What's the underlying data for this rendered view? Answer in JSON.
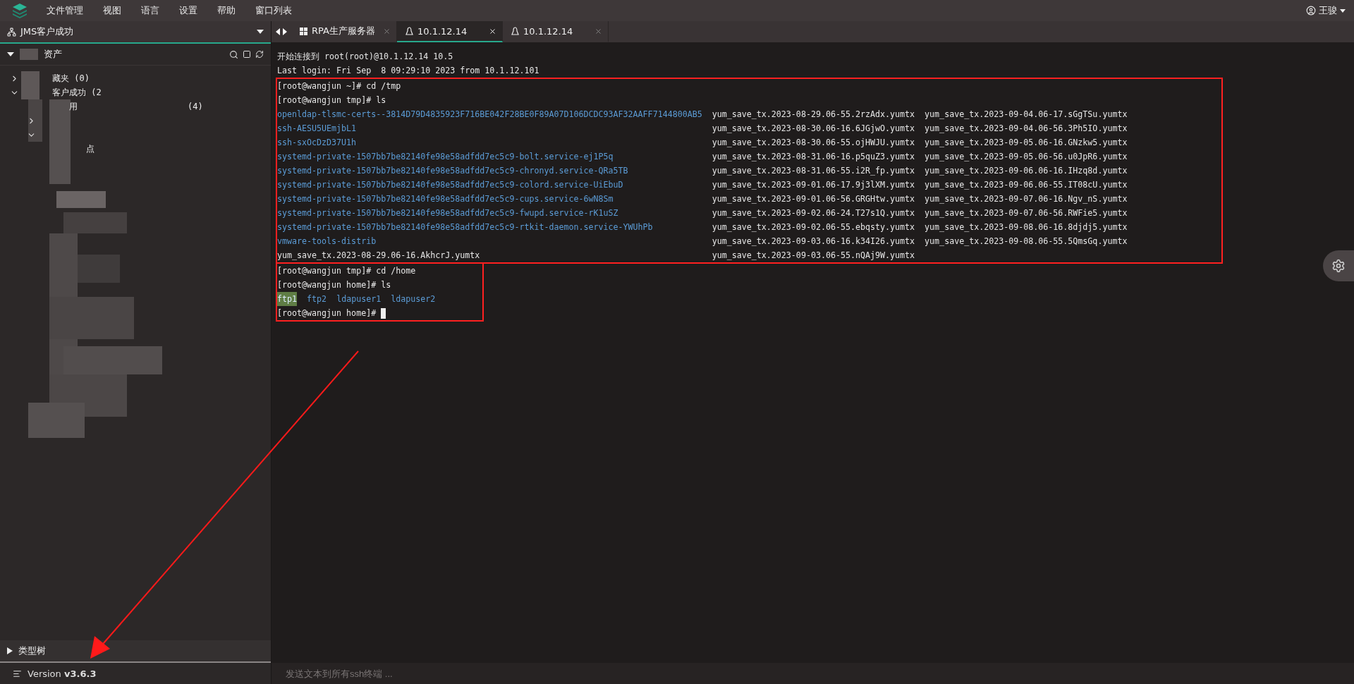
{
  "menu_bar": {
    "items": [
      "文件管理",
      "视图",
      "语言",
      "设置",
      "帮助",
      "窗口列表"
    ],
    "user": "王骏"
  },
  "sidebar": {
    "workspace": "JMS客户成功",
    "section": {
      "title": "资产",
      "expanded": true
    },
    "tree": [
      {
        "label": "藏夹 (0)",
        "expanded": false
      },
      {
        "label": "客户成功 (2",
        "expanded": true,
        "children": [
          {
            "label": "用",
            "count": "(4)"
          },
          {
            "expanded": false
          },
          {
            "expanded": true,
            "children": [
              {
                "label": "点"
              }
            ]
          }
        ]
      }
    ],
    "footer_section": {
      "title": "类型树",
      "expanded": false
    },
    "version_label": "Version",
    "version": "v3.6.3"
  },
  "tabs": [
    {
      "label": "RPA生产服务器",
      "kind": "windows",
      "selected": false
    },
    {
      "label": "10.1.12.14",
      "kind": "linux",
      "selected": true
    },
    {
      "label": "10.1.12.14",
      "kind": "linux",
      "selected": false
    }
  ],
  "terminal": {
    "groups": [
      {
        "highlighted": false,
        "lines": [
          {
            "kind": "text",
            "text": "开始连接到 root(root)@10.1.12.14 10.5"
          },
          {
            "kind": "text",
            "text": "Last login: Fri Sep  8 09:29:10 2023 from 10.1.12.101"
          }
        ]
      },
      {
        "highlighted": true,
        "lines": [
          {
            "kind": "text",
            "text": "[root@wangjun ~]# cd /tmp"
          },
          {
            "kind": "text",
            "text": "[root@wangjun tmp]# ls"
          },
          {
            "kind": "listing",
            "columns": [
              [
                {
                  "name": "openldap-tlsmc-certs--3814D79D4835923F716BE042F28BE0F89A07D106DCDC93AF32AAFF7144800AB5",
                  "kind": "dir"
                },
                {
                  "name": "ssh-AESU5UEmjbL1",
                  "kind": "dir"
                },
                {
                  "name": "ssh-sxOcDzD37U1h",
                  "kind": "dir"
                },
                {
                  "name": "systemd-private-1507bb7be82140fe98e58adfdd7ec5c9-bolt.service-ej1P5q",
                  "kind": "dir"
                },
                {
                  "name": "systemd-private-1507bb7be82140fe98e58adfdd7ec5c9-chronyd.service-QRa5TB",
                  "kind": "dir"
                },
                {
                  "name": "systemd-private-1507bb7be82140fe98e58adfdd7ec5c9-colord.service-UiEbuD",
                  "kind": "dir"
                },
                {
                  "name": "systemd-private-1507bb7be82140fe98e58adfdd7ec5c9-cups.service-6wN8Sm",
                  "kind": "dir"
                },
                {
                  "name": "systemd-private-1507bb7be82140fe98e58adfdd7ec5c9-fwupd.service-rK1uSZ",
                  "kind": "dir"
                },
                {
                  "name": "systemd-private-1507bb7be82140fe98e58adfdd7ec5c9-rtkit-daemon.service-YWUhPb",
                  "kind": "dir"
                },
                {
                  "name": "vmware-tools-distrib",
                  "kind": "dir"
                },
                {
                  "name": "yum_save_tx.2023-08-29.06-16.AkhcrJ.yumtx",
                  "kind": "file"
                }
              ],
              [
                {
                  "name": "yum_save_tx.2023-08-29.06-55.2rzAdx.yumtx",
                  "kind": "file"
                },
                {
                  "name": "yum_save_tx.2023-08-30.06-16.6JGjwO.yumtx",
                  "kind": "file"
                },
                {
                  "name": "yum_save_tx.2023-08-30.06-55.ojHWJU.yumtx",
                  "kind": "file"
                },
                {
                  "name": "yum_save_tx.2023-08-31.06-16.p5quZ3.yumtx",
                  "kind": "file"
                },
                {
                  "name": "yum_save_tx.2023-08-31.06-55.i2R_fp.yumtx",
                  "kind": "file"
                },
                {
                  "name": "yum_save_tx.2023-09-01.06-17.9j3lXM.yumtx",
                  "kind": "file"
                },
                {
                  "name": "yum_save_tx.2023-09-01.06-56.GRGHtw.yumtx",
                  "kind": "file"
                },
                {
                  "name": "yum_save_tx.2023-09-02.06-24.T27s1Q.yumtx",
                  "kind": "file"
                },
                {
                  "name": "yum_save_tx.2023-09-02.06-55.ebqsty.yumtx",
                  "kind": "file"
                },
                {
                  "name": "yum_save_tx.2023-09-03.06-16.k34I26.yumtx",
                  "kind": "file"
                },
                {
                  "name": "yum_save_tx.2023-09-03.06-55.nQAj9W.yumtx",
                  "kind": "file"
                }
              ],
              [
                {
                  "name": "yum_save_tx.2023-09-04.06-17.sGgTSu.yumtx",
                  "kind": "file"
                },
                {
                  "name": "yum_save_tx.2023-09-04.06-56.3Ph5IO.yumtx",
                  "kind": "file"
                },
                {
                  "name": "yum_save_tx.2023-09-05.06-16.GNzkw5.yumtx",
                  "kind": "file"
                },
                {
                  "name": "yum_save_tx.2023-09-05.06-56.u0JpR6.yumtx",
                  "kind": "file"
                },
                {
                  "name": "yum_save_tx.2023-09-06.06-16.IHzq8d.yumtx",
                  "kind": "file"
                },
                {
                  "name": "yum_save_tx.2023-09-06.06-55.IT08cU.yumtx",
                  "kind": "file"
                },
                {
                  "name": "yum_save_tx.2023-09-07.06-16.Ngv_nS.yumtx",
                  "kind": "file"
                },
                {
                  "name": "yum_save_tx.2023-09-07.06-56.RWFie5.yumtx",
                  "kind": "file"
                },
                {
                  "name": "yum_save_tx.2023-09-08.06-16.8djdj5.yumtx",
                  "kind": "file"
                },
                {
                  "name": "yum_save_tx.2023-09-08.06-55.5QmsGq.yumtx",
                  "kind": "file"
                }
              ]
            ]
          }
        ]
      },
      {
        "highlighted": true,
        "lines": [
          {
            "kind": "text",
            "text": "[root@wangjun tmp]# cd /home"
          },
          {
            "kind": "text",
            "text": "[root@wangjun home]# ls"
          },
          {
            "kind": "listing",
            "columns": [
              [
                {
                  "name": "ftp1",
                  "kind": "sticky_dir"
                }
              ],
              [
                {
                  "name": "ftp2",
                  "kind": "dir"
                }
              ],
              [
                {
                  "name": "ldapuser1",
                  "kind": "dir"
                }
              ],
              [
                {
                  "name": "ldapuser2",
                  "kind": "dir"
                }
              ]
            ]
          },
          {
            "kind": "prompt",
            "text": "[root@wangjun home]# "
          }
        ]
      }
    ]
  },
  "broadcast": {
    "placeholder": "发送文本到所有ssh终端 ..."
  }
}
